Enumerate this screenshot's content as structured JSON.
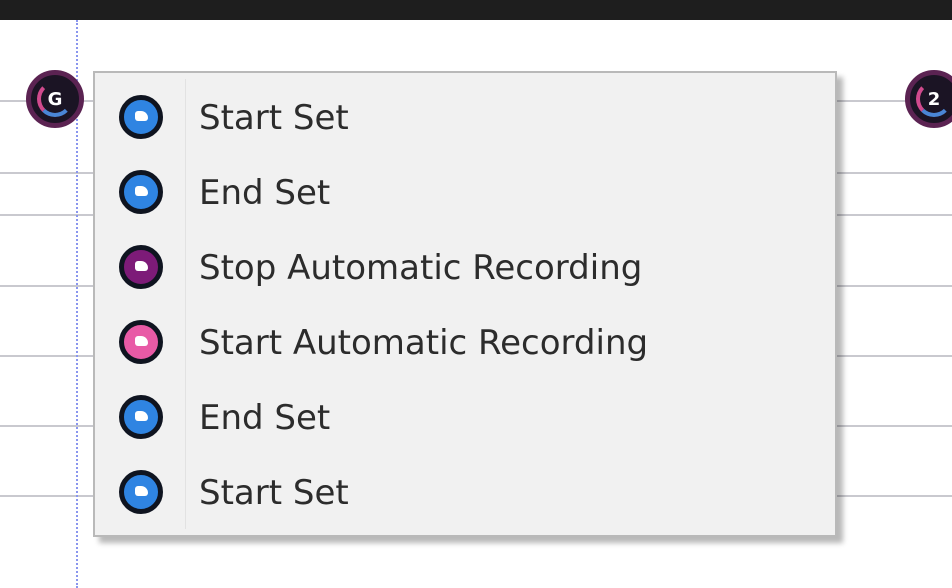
{
  "markers": {
    "left_label": "G",
    "right_label": "2"
  },
  "menu": {
    "items": [
      {
        "label": "Start Set",
        "icon": "set-start-icon",
        "color": "#2f84e2"
      },
      {
        "label": "End Set",
        "icon": "set-end-icon",
        "color": "#2f84e2"
      },
      {
        "label": "Stop Automatic Recording",
        "icon": "stop-recording-icon",
        "color": "#7d1b78"
      },
      {
        "label": "Start Automatic Recording",
        "icon": "start-recording-icon",
        "color": "#e85aa6"
      },
      {
        "label": "End Set",
        "icon": "set-end-icon",
        "color": "#2f84e2"
      },
      {
        "label": "Start Set",
        "icon": "set-start-icon",
        "color": "#2f84e2"
      }
    ]
  }
}
